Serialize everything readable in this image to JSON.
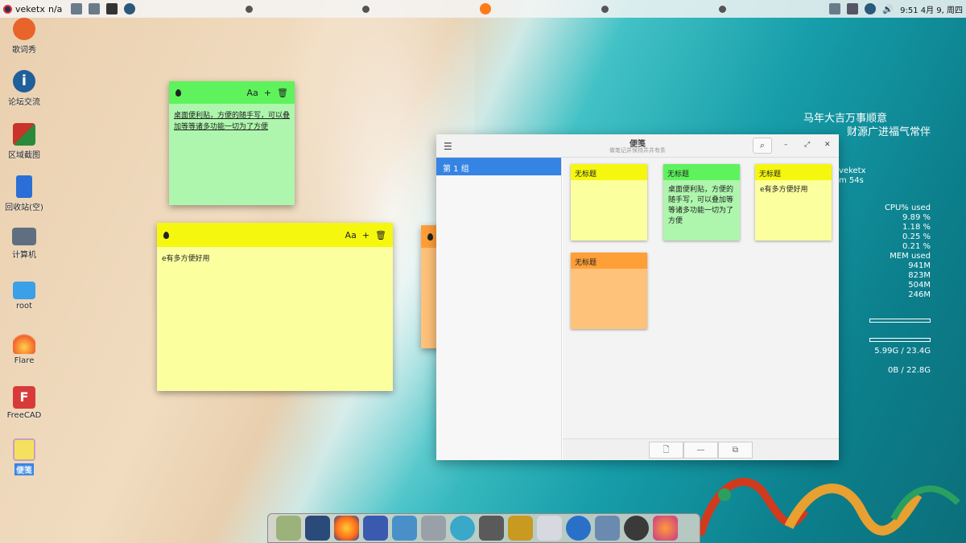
{
  "panel": {
    "user": "veketx",
    "status": "n/a",
    "clock": "9:51 4月 9, 周四"
  },
  "desktop_icons": [
    {
      "label": "歌词秀",
      "icon": "lyrics-icon",
      "color": "#e8642a"
    },
    {
      "label": "论坛交流",
      "icon": "info-icon",
      "color": "#1f5f9a"
    },
    {
      "label": "区域截图",
      "icon": "screenshot-icon",
      "color": "#c8332a"
    },
    {
      "label": "回收站(空)",
      "icon": "trash-icon",
      "color": "#2a6ed6"
    },
    {
      "label": "计算机",
      "icon": "computer-icon",
      "color": "#5f6f7f"
    },
    {
      "label": "root",
      "icon": "home-folder-icon",
      "color": "#3aa0e8"
    },
    {
      "label": "Flare",
      "icon": "flare-icon",
      "color": "#f2612a"
    },
    {
      "label": "FreeCAD",
      "icon": "freecad-icon",
      "color": "#d83a3a"
    },
    {
      "label": "便笺",
      "icon": "sticky-notes-icon",
      "color": "#f5e060"
    }
  ],
  "notes": {
    "green_text": "桌面便利贴，方便的随手写，可以叠加等等诸多功能一切为了方便",
    "yellow_text": "e有多方便好用",
    "orange_text": "",
    "tools": {
      "font": "Aa",
      "add": "+",
      "delete": "🗑"
    }
  },
  "conky": {
    "line1": "马年大吉万事顺意",
    "line2": "财源广进福气常伴",
    "user": "veketx",
    "uptime": "m 54s",
    "cpu_header": "CPU% used",
    "cpu": [
      "9.89 %",
      "1.18 %",
      "0.25 %",
      "0.21 %"
    ],
    "mem_header": "MEM used",
    "mem": [
      "941M",
      "823M",
      "504M",
      "246M"
    ],
    "disk1": "5.99G / 23.4G",
    "disk2": "0B / 22.8G"
  },
  "app": {
    "title": "便笺",
    "subtitle": "做笔记并保持井井有条",
    "sidebar_group": "第 1 组",
    "cards": [
      {
        "title": "无标题",
        "body": "",
        "color": "yellow"
      },
      {
        "title": "无标题",
        "body": "桌面便利贴，方便的随手写，可以叠加等等诸多功能一切为了方便",
        "color": "green"
      },
      {
        "title": "无标题",
        "body": "e有多方便好用",
        "color": "yellow"
      },
      {
        "title": "无标题",
        "body": "",
        "color": "orange"
      }
    ]
  },
  "dock": {
    "icons": [
      "files-icon",
      "monitor-icon",
      "firefox-icon",
      "editor-icon",
      "paint-icon",
      "network-icon",
      "atom-icon",
      "camera-icon",
      "book-icon",
      "chart-icon",
      "globe-icon",
      "settings-icon",
      "obs-icon",
      "firefox-orange-icon"
    ]
  }
}
